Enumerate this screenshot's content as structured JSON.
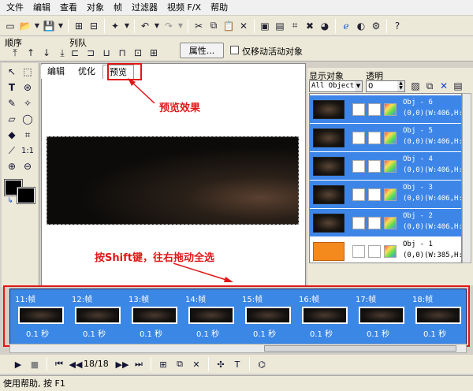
{
  "menu": [
    "文件",
    "编辑",
    "查看",
    "对象",
    "帧",
    "过滤器",
    "视频 F/X",
    "帮助"
  ],
  "toolbar2": {
    "order_label": "顺序",
    "queue_label": "列队",
    "properties_button": "属性...",
    "only_moving_label": "仅移动活动对象"
  },
  "editor_tabs": [
    "编辑",
    "优化",
    "预览"
  ],
  "right_panel": {
    "display_objects_label": "显示对象",
    "transparency_label": "透明",
    "display_select_value": "All Object:",
    "transparency_value": "0"
  },
  "objects": [
    {
      "name": "Obj - 6",
      "coords": "(0,0)(W:406,H:"
    },
    {
      "name": "Obj - 5",
      "coords": "(0,0)(W:406,H:"
    },
    {
      "name": "Obj - 4",
      "coords": "(0,0)(W:406,H:"
    },
    {
      "name": "Obj - 3",
      "coords": "(0,0)(W:406,H:"
    },
    {
      "name": "Obj - 2",
      "coords": "(0,0)(W:406,H:"
    },
    {
      "name": "Obj - 1",
      "coords": "(0,0)(W:385,H:"
    }
  ],
  "frames": [
    {
      "label": "11:帧",
      "delay": "0.1 秒"
    },
    {
      "label": "12:帧",
      "delay": "0.1 秒"
    },
    {
      "label": "13:帧",
      "delay": "0.1 秒"
    },
    {
      "label": "14:帧",
      "delay": "0.1 秒"
    },
    {
      "label": "15:帧",
      "delay": "0.1 秒"
    },
    {
      "label": "16:帧",
      "delay": "0.1 秒"
    },
    {
      "label": "17:帧",
      "delay": "0.1 秒"
    },
    {
      "label": "18:帧",
      "delay": "0.1 秒"
    }
  ],
  "playbar": {
    "frame_counter": "18/18"
  },
  "status": "使用帮助, 按 F1",
  "annotations": {
    "preview_note": "预览效果",
    "select_note": "按Shift键，往右拖动全选"
  },
  "colors": {
    "selection_blue": "#3b87e6",
    "annotation_red": "#e01818"
  }
}
